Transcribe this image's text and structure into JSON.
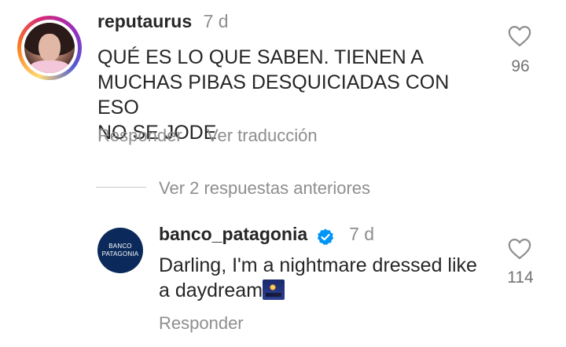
{
  "comments": [
    {
      "username": "reputaurus",
      "time": "7 d",
      "text_lines": [
        "QUÉ ES LO QUE SABEN. TIENEN A",
        "MUCHAS PIBAS DESQUICIADAS CON ESO",
        "NO SE JODE"
      ],
      "actions": {
        "reply": "Responder",
        "translate": "Ver traducción"
      },
      "likes": "96"
    },
    {
      "username": "banco_patagonia",
      "verified": true,
      "time": "7 d",
      "text_lines": [
        "Darling, I'm a nightmare dressed like",
        "a daydream"
      ],
      "emoji": "night-with-stars-emoji",
      "actions": {
        "reply": "Responder"
      },
      "likes": "114",
      "avatar_logo_lines": [
        "BANCO",
        "PATAGONIA"
      ]
    }
  ],
  "replies_toggle": "Ver 2 respuestas anteriores",
  "colors": {
    "text": "#262626",
    "muted": "#8e8e8e",
    "verified": "#0095f6",
    "bank_navy": "#0b2a5b"
  },
  "icons": [
    "heart-outline-icon",
    "verified-badge-icon"
  ]
}
